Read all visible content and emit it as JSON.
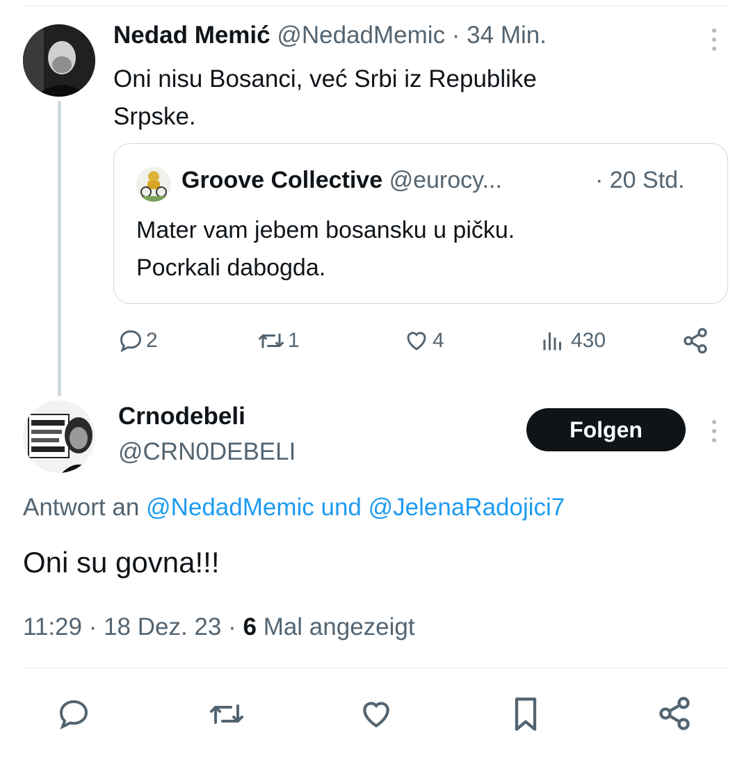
{
  "parent_tweet": {
    "author_name": "Nedad Memić",
    "handle_time": "@NedadMemic · 34 Min.",
    "text_line1": "Oni nisu Bosanci, već Srbi iz Republike",
    "text_line2": "Srpske.",
    "quote": {
      "author_name": "Groove Collective",
      "handle": "@eurocy...",
      "time": "· 20 Std.",
      "text_line1": "Mater vam jebem bosansku u pičku.",
      "text_line2": "Pocrkali dabogda."
    },
    "actions": {
      "replies": "2",
      "retweets": "1",
      "likes": "4",
      "views": "430"
    }
  },
  "main_tweet": {
    "author_name": "Crnodebeli",
    "handle": "@CRN0DEBELI",
    "follow_label": "Folgen",
    "reply_prefix": "Antwort an",
    "reply_user1": "@NedadMemic",
    "reply_and": "und",
    "reply_user2": "@JelenaRadojici7",
    "text": "Oni su govna!!!",
    "meta_time": "11:29 · 18 Dez. 23 ·",
    "meta_views": "6",
    "meta_views_label": "Mal angezeigt"
  },
  "icons": [
    "reply-icon",
    "retweet-icon",
    "like-icon",
    "views-icon",
    "share-icon",
    "bookmark-icon",
    "more-icon"
  ]
}
